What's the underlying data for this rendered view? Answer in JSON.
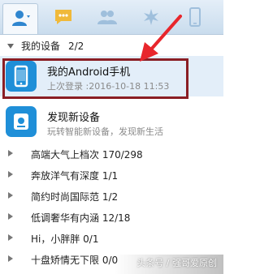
{
  "tabs": [
    {
      "icon": "contacts-icon",
      "active": true
    },
    {
      "icon": "chat-icon",
      "active": false
    },
    {
      "icon": "group-icon",
      "active": false
    },
    {
      "icon": "apps-icon",
      "active": false
    },
    {
      "icon": "phone-icon",
      "active": false
    }
  ],
  "my_devices": {
    "label": "我的设备",
    "count": "2/2",
    "items": [
      {
        "title": "我的Android手机",
        "subtitle": "上次登录 :2016-10-18 11:53",
        "icon": "android-phone-icon"
      },
      {
        "title": "发现新设备",
        "subtitle": "玩转智能新设备，发现新生活",
        "icon": "discover-device-icon"
      }
    ]
  },
  "groups": [
    {
      "name": "高端大气上档次 170/298"
    },
    {
      "name": "奔放洋气有深度 1/1"
    },
    {
      "name": "简约时尚国际范 1/2"
    },
    {
      "name": "低调奢华有内涵 12/18"
    },
    {
      "name": "Hi，小胖胖 0/1"
    },
    {
      "name": "十盘矫情无下限 0/0"
    }
  ],
  "watermark": "头条号 / 强哥爱原创",
  "colors": {
    "accent": "#1f8fd8",
    "highlight": "#8a1e24",
    "tab_icon": "#6fa6d2"
  }
}
